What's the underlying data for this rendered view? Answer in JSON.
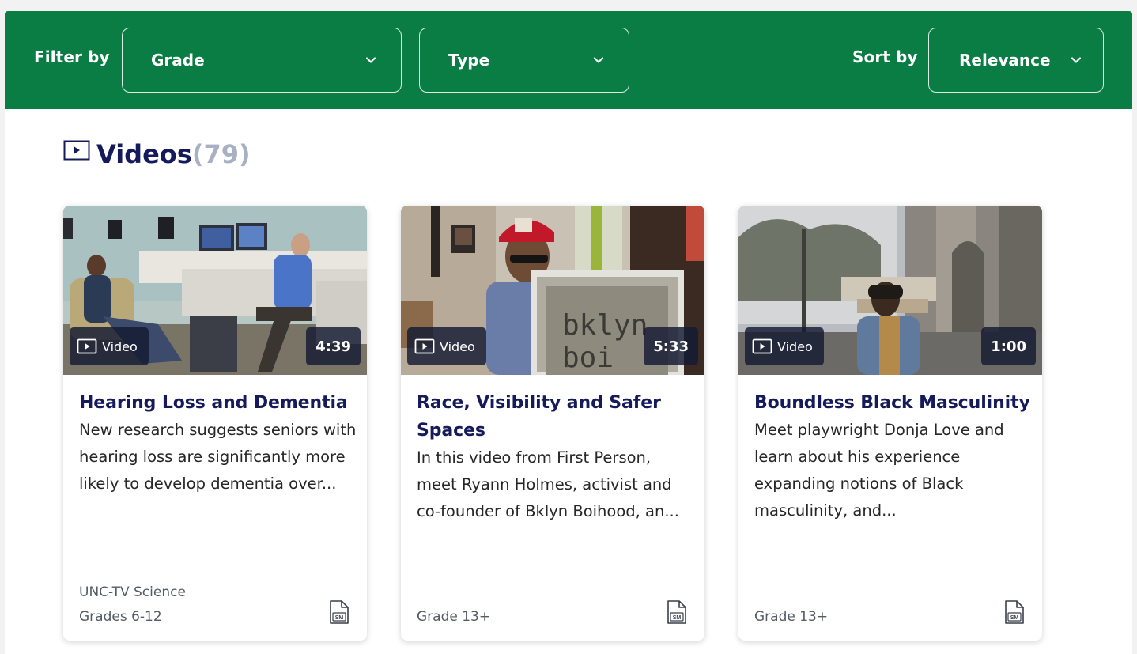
{
  "filters": {
    "filter_label": "Filter by",
    "grade_value": "Grade",
    "type_value": "Type",
    "sort_label": "Sort by",
    "sort_value": "Relevance"
  },
  "section": {
    "title": "Videos",
    "count": "(79)"
  },
  "cards": [
    {
      "badge": "Video",
      "duration": "4:39",
      "title": "Hearing Loss and Dementia",
      "description": "New research suggests seniors with hearing loss are significantly more likely to develop dementia over...",
      "source": "UNC-TV Science",
      "grades": "Grades 6-12",
      "format_icon": "SM"
    },
    {
      "badge": "Video",
      "duration": "5:33",
      "title": "Race, Visibility and Safer Spaces",
      "description": "In this video from First Person, meet Ryann Holmes, activist and co-founder of Bklyn Boihood, an...",
      "source": "",
      "grades": "Grade 13+",
      "format_icon": "SM",
      "thumb_text": [
        "bklyn",
        "boi"
      ]
    },
    {
      "badge": "Video",
      "duration": "1:00",
      "title": "Boundless Black Masculinity",
      "description": "Meet playwright Donja Love and learn about his experience expanding notions of Black masculinity, and...",
      "source": "",
      "grades": "Grade 13+",
      "format_icon": "SM"
    }
  ],
  "colors": {
    "brand_green": "#0a7d44",
    "title_navy": "#141a5a",
    "count_gray": "#aab0c4"
  },
  "icons": {
    "chevron": "chevron-down-icon",
    "video": "play-square-icon",
    "format": "sm-document-icon"
  }
}
